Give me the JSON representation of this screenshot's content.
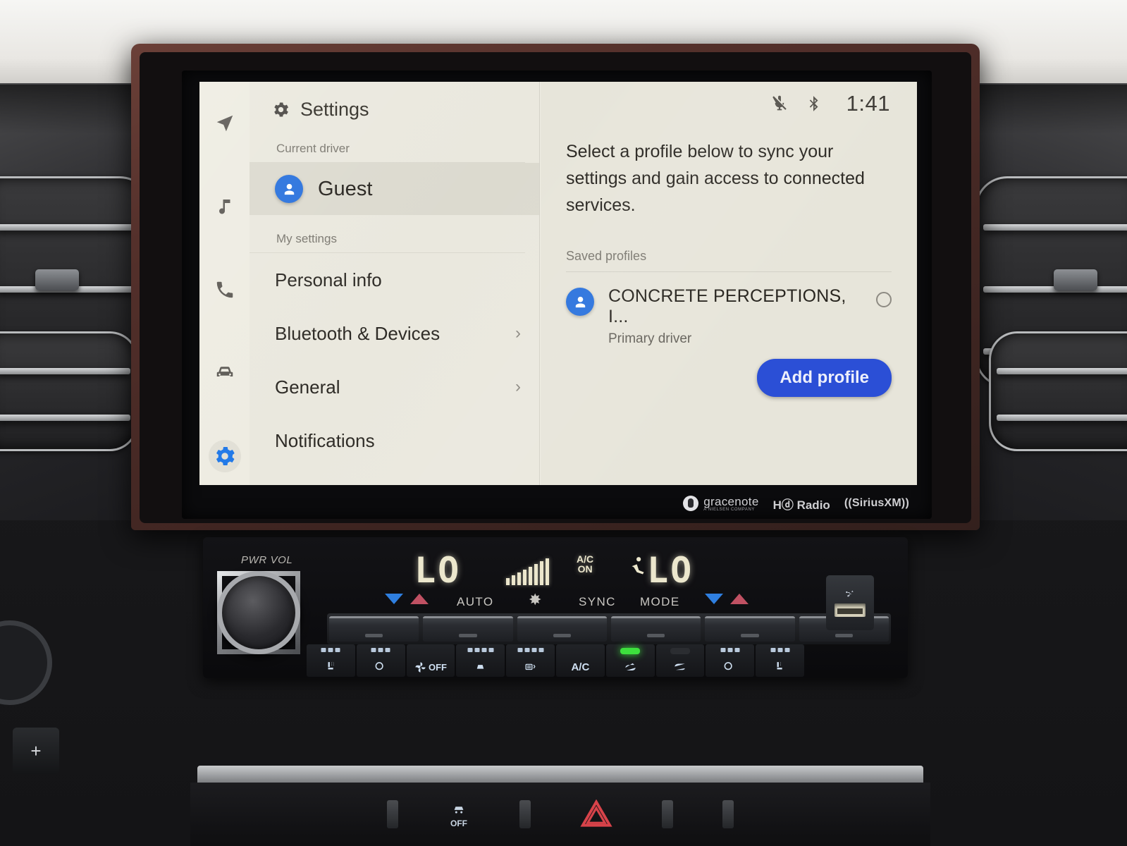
{
  "lcd": {
    "rail": [
      {
        "name": "navigation-icon",
        "label": "Navigation"
      },
      {
        "name": "media-icon",
        "label": "Media"
      },
      {
        "name": "phone-icon",
        "label": "Phone"
      },
      {
        "name": "vehicle-icon",
        "label": "Vehicle"
      },
      {
        "name": "settings-icon",
        "label": "Settings",
        "active": true
      }
    ],
    "left_panel": {
      "title": "Settings",
      "current_driver_label": "Current driver",
      "current_driver": "Guest",
      "my_settings_label": "My settings",
      "menu": [
        {
          "label": "Personal info",
          "chevron": ""
        },
        {
          "label": "Bluetooth & Devices",
          "chevron": "›"
        },
        {
          "label": "General",
          "chevron": "›"
        },
        {
          "label": "Notifications",
          "chevron": ""
        }
      ]
    },
    "status_bar": {
      "time": "1:41",
      "mic_muted_icon": "mic-muted-icon",
      "bluetooth_icon": "bluetooth-icon"
    },
    "right_panel": {
      "lead_text": "Select a profile below to sync your settings and gain access to connected services.",
      "saved_profiles_label": "Saved profiles",
      "profiles": [
        {
          "name": "CONCRETE PERCEPTIONS, I...",
          "role": "Primary driver",
          "selected": false
        }
      ],
      "add_profile_label": "Add profile"
    },
    "search_fab": "search-icon"
  },
  "brand_bar": {
    "gracenote": "gracenote",
    "gracenote_sub": "A NIELSEN COMPANY",
    "hd_radio": "Hⓓ Radio",
    "siriusxm": "((SiriusXM))"
  },
  "climate": {
    "pwr_vol_label": "PWR VOL",
    "temp_left": "LO",
    "temp_right": "LO",
    "ac_on_top": "A/C",
    "ac_on_bottom": "ON",
    "labels": {
      "auto": "AUTO",
      "fan": "✸",
      "sync": "SYNC",
      "mode": "MODE"
    },
    "buttons": [
      {
        "name": "seat-heater-left-button",
        "label": "",
        "icon": "seat-heat-icon",
        "lamp": "off",
        "bars": 3
      },
      {
        "name": "steering-wheel-heater-button",
        "label": "",
        "icon": "wheel-heat-icon",
        "lamp": "off",
        "bars": 3
      },
      {
        "name": "climate-off-button",
        "label": "OFF",
        "icon": "fan-icon",
        "lamp": "none",
        "bars": 0
      },
      {
        "name": "front-defrost-button",
        "label": "",
        "icon": "front-defrost-icon",
        "lamp": "off",
        "bars": 4
      },
      {
        "name": "rear-defrost-button",
        "label": "",
        "icon": "rear-defrost-icon",
        "lamp": "off",
        "bars": 4
      },
      {
        "name": "ac-button",
        "label": "A/C",
        "icon": "",
        "lamp": "none",
        "bars": 0
      },
      {
        "name": "recirculate-button",
        "label": "",
        "icon": "recirc-icon",
        "lamp": "on",
        "bars": 0
      },
      {
        "name": "fresh-air-button",
        "label": "",
        "icon": "fresh-air-icon",
        "lamp": "off",
        "bars": 4
      },
      {
        "name": "steering-wheel-heater-2-button",
        "label": "",
        "icon": "wheel-heat-icon",
        "lamp": "off",
        "bars": 3
      },
      {
        "name": "seat-heater-right-button",
        "label": "",
        "icon": "seat-heat-icon",
        "lamp": "off",
        "bars": 3
      }
    ],
    "usb_icon": "usb-icon"
  },
  "lower_console": {
    "hazard_icon": "hazard-triangle-icon",
    "traction_control_label": "OFF",
    "traction_control_icon": "traction-control-icon"
  },
  "colors": {
    "accent_blue": "#2b7ae8",
    "button_blue": "#2b4fd6",
    "avatar_blue": "#2a72dd",
    "lcd_bg": "#e7e5da",
    "bezel": "#54302b",
    "segment": "#ece7cd",
    "led_green": "#3de03d"
  }
}
